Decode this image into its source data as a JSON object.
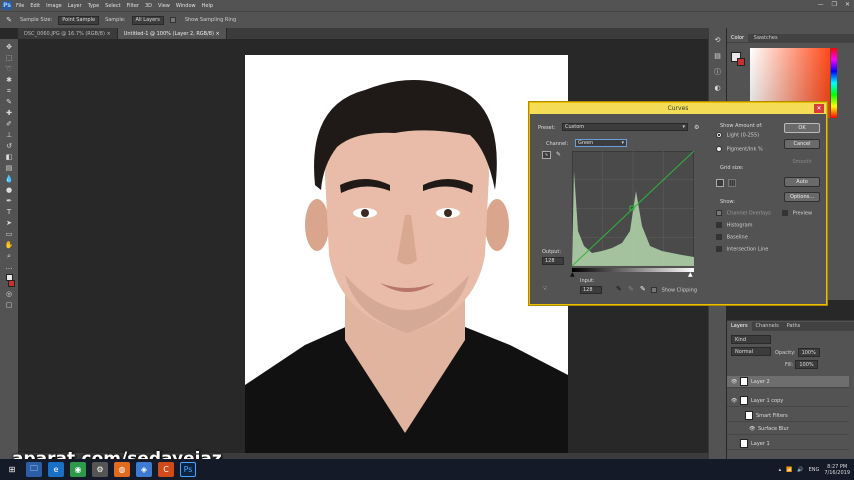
{
  "menu": {
    "logo": "Ps",
    "items": [
      "File",
      "Edit",
      "Image",
      "Layer",
      "Type",
      "Select",
      "Filter",
      "3D",
      "View",
      "Window",
      "Help"
    ],
    "window_controls": [
      "—",
      "❐",
      "✕"
    ]
  },
  "options": {
    "sample_size_label": "Sample Size:",
    "sample_size_value": "Point Sample",
    "sample_label": "Sample:",
    "sample_value": "All Layers",
    "show_ring_label": "Show Sampling Ring"
  },
  "tabs": [
    {
      "label": "DSC_0060.JPG @ 16.7% (RGB/8) ×"
    },
    {
      "label": "Untitled-1 @ 100% (Layer 2, RGB/8) ×"
    }
  ],
  "color_panel": {
    "tabs": [
      "Color",
      "Swatches"
    ]
  },
  "layers_panel": {
    "tabs": [
      "Layers",
      "Channels",
      "Paths"
    ],
    "filter_placeholder": "Kind",
    "blend_mode": "Normal",
    "opacity_label": "Opacity:",
    "opacity_value": "100%",
    "fill_label": "Fill:",
    "fill_value": "100%",
    "layers": [
      {
        "name": "Layer 2"
      },
      {
        "name": "Layer 1 copy"
      },
      {
        "name": "Smart Filters"
      },
      {
        "name": "Surface Blur"
      },
      {
        "name": "Layer 1"
      }
    ]
  },
  "curves": {
    "title": "Curves",
    "preset_label": "Preset:",
    "preset_value": "Custom",
    "channel_label": "Channel:",
    "channel_value": "Green",
    "output_label": "Output:",
    "output_value": "128",
    "input_label": "Input:",
    "input_value": "128",
    "show_amount_title": "Show Amount of:",
    "light_label": "Light (0-255)",
    "pigment_label": "Pigment/Ink %",
    "grid_size_label": "Grid size:",
    "show_label": "Show:",
    "channel_overlays_label": "Channel Overlays",
    "histogram_label": "Histogram",
    "baseline_label": "Baseline",
    "intersection_label": "Intersection Line",
    "clipping_label": "Show Clipping",
    "ok_label": "OK",
    "cancel_label": "Cancel",
    "smooth_label": "Smooth",
    "auto_label": "Auto",
    "options_label": "Options...",
    "preview_label": "Preview",
    "preview_checked": true
  },
  "watermark": "aparat.com/sedayejaz",
  "taskbar": {
    "tray_lang": "ENG",
    "time": "8:27 PM",
    "date": "7/16/2019"
  }
}
